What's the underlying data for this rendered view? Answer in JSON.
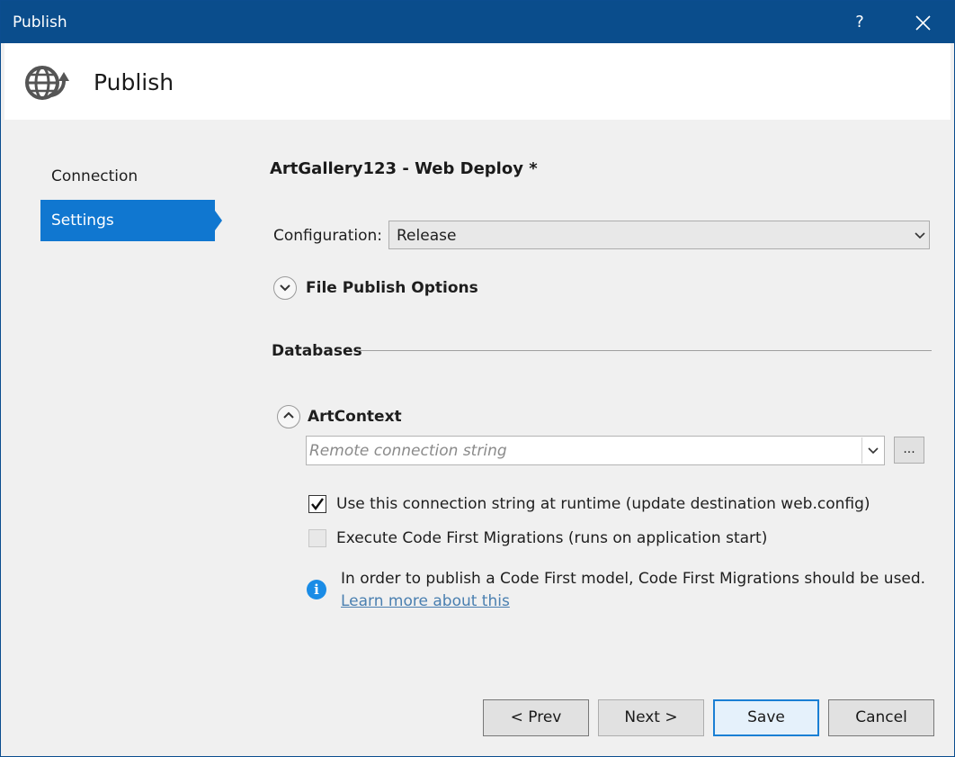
{
  "window": {
    "title": "Publish",
    "help_label": "?"
  },
  "header": {
    "title": "Publish",
    "icon": "globe-publish-icon"
  },
  "nav": {
    "items": [
      {
        "label": "Connection",
        "selected": false
      },
      {
        "label": "Settings",
        "selected": true
      }
    ]
  },
  "main": {
    "profile_title": "ArtGallery123 - Web Deploy *",
    "configuration": {
      "label": "Configuration:",
      "value": "Release"
    },
    "file_publish_options": {
      "label": "File Publish Options",
      "expanded": false
    },
    "databases": {
      "label": "Databases",
      "context": {
        "name": "ArtContext",
        "expanded": true,
        "connection_placeholder": "Remote connection string",
        "browse_label": "...",
        "use_runtime": {
          "label": "Use this connection string at runtime (update destination web.config)",
          "checked": true
        },
        "migrations": {
          "label": "Execute Code First Migrations (runs on application start)",
          "checked": false,
          "enabled": false
        }
      },
      "info": {
        "text": "In order to publish a Code First model, Code First Migrations should be used.",
        "link": "Learn more about this"
      }
    }
  },
  "footer": {
    "prev": "< Prev",
    "next": "Next >",
    "save": "Save",
    "cancel": "Cancel"
  },
  "colors": {
    "titlebar": "#0a4d8c",
    "accent": "#1077d0",
    "info": "#1a8ce6",
    "link": "#4a7fb0"
  }
}
